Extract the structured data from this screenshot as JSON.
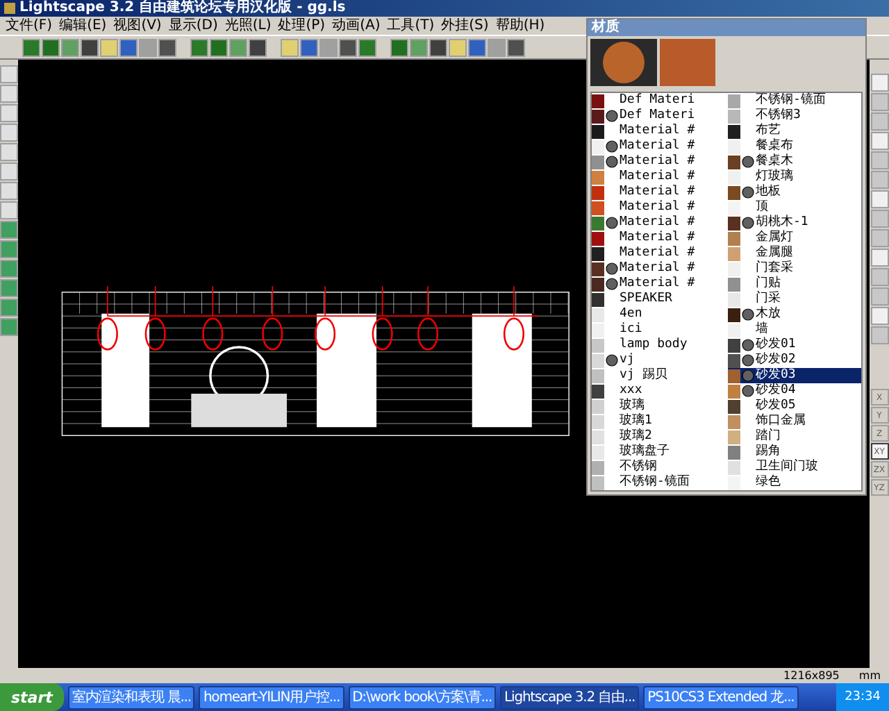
{
  "window": {
    "title": "Lightscape 3.2 自由建筑论坛专用汉化版 - gg.ls"
  },
  "menu": [
    "文件(F)",
    "编辑(E)",
    "视图(V)",
    "显示(D)",
    "光照(L)",
    "处理(P)",
    "动画(A)",
    "工具(T)",
    "外挂(S)",
    "帮助(H)"
  ],
  "axis_buttons": [
    {
      "label": "X",
      "selected": false
    },
    {
      "label": "Y",
      "selected": false
    },
    {
      "label": "Z",
      "selected": false
    },
    {
      "label": "XY",
      "selected": true
    },
    {
      "label": "ZX",
      "selected": false
    },
    {
      "label": "YZ",
      "selected": false
    }
  ],
  "materials_panel": {
    "title": "材质",
    "items": [
      {
        "label": "Def Materi",
        "textured": false,
        "selected": false,
        "color": "#7a1010"
      },
      {
        "label": "Def Materi",
        "textured": true,
        "selected": false,
        "color": "#5a1a1a"
      },
      {
        "label": "Material #",
        "textured": false,
        "selected": false,
        "color": "#1a1a1a"
      },
      {
        "label": "Material #",
        "textured": true,
        "selected": false,
        "color": "#f0f0f0"
      },
      {
        "label": "Material #",
        "textured": true,
        "selected": false,
        "color": "#909090"
      },
      {
        "label": "Material #",
        "textured": false,
        "selected": false,
        "color": "#d08040"
      },
      {
        "label": "Material #",
        "textured": false,
        "selected": false,
        "color": "#c03010"
      },
      {
        "label": "Material #",
        "textured": false,
        "selected": false,
        "color": "#d05020"
      },
      {
        "label": "Material #",
        "textured": true,
        "selected": false,
        "color": "#3a7a30"
      },
      {
        "label": "Material #",
        "textured": false,
        "selected": false,
        "color": "#a01010"
      },
      {
        "label": "Material #",
        "textured": false,
        "selected": false,
        "color": "#202020"
      },
      {
        "label": "Material #",
        "textured": true,
        "selected": false,
        "color": "#5a3020"
      },
      {
        "label": "Material #",
        "textured": true,
        "selected": false,
        "color": "#4a2a20"
      },
      {
        "label": "SPEAKER",
        "textured": false,
        "selected": false,
        "color": "#303030"
      },
      {
        "label": "4en",
        "textured": false,
        "selected": false,
        "color": "#e8e8e8"
      },
      {
        "label": "ici",
        "textured": false,
        "selected": false,
        "color": "#f0f0f0"
      },
      {
        "label": "lamp body",
        "textured": false,
        "selected": false,
        "color": "#c8c8c8"
      },
      {
        "label": "vj",
        "textured": true,
        "selected": false,
        "color": "#d8d8d8"
      },
      {
        "label": "vj 踢贝",
        "textured": false,
        "selected": false,
        "color": "#c0c0c0"
      },
      {
        "label": "xxx",
        "textured": false,
        "selected": false,
        "color": "#404040"
      },
      {
        "label": "玻璃",
        "textured": false,
        "selected": false,
        "color": "#d0d0d0"
      },
      {
        "label": "玻璃1",
        "textured": false,
        "selected": false,
        "color": "#d8d8d8"
      },
      {
        "label": "玻璃2",
        "textured": false,
        "selected": false,
        "color": "#e0e0e0"
      },
      {
        "label": "玻璃盘子",
        "textured": false,
        "selected": false,
        "color": "#e8e8e8"
      },
      {
        "label": "不锈钢",
        "textured": false,
        "selected": false,
        "color": "#b0b0b0"
      },
      {
        "label": "不锈钢-镜面",
        "textured": false,
        "selected": false,
        "color": "#c0c0c0"
      },
      {
        "label": "不锈钢-镜面",
        "textured": false,
        "selected": false,
        "color": "#a8a8a8"
      },
      {
        "label": "不锈钢3",
        "textured": false,
        "selected": false,
        "color": "#b8b8b8"
      },
      {
        "label": "布艺",
        "textured": false,
        "selected": false,
        "color": "#202020"
      },
      {
        "label": "餐桌布",
        "textured": false,
        "selected": false,
        "color": "#f0f0f0"
      },
      {
        "label": "餐桌木",
        "textured": true,
        "selected": false,
        "color": "#6a4020"
      },
      {
        "label": "灯玻璃",
        "textured": false,
        "selected": false,
        "color": "#f0f0f0"
      },
      {
        "label": "地板",
        "textured": true,
        "selected": false,
        "color": "#7a4a20"
      },
      {
        "label": "顶",
        "textured": false,
        "selected": false,
        "color": "#f4f4f4"
      },
      {
        "label": "胡桃木-1",
        "textured": true,
        "selected": false,
        "color": "#5a3020"
      },
      {
        "label": "金属灯",
        "textured": false,
        "selected": false,
        "color": "#b08050"
      },
      {
        "label": "金属腿",
        "textured": false,
        "selected": false,
        "color": "#d0a070"
      },
      {
        "label": "门套采",
        "textured": false,
        "selected": false,
        "color": "#f0f0f0"
      },
      {
        "label": "门贴",
        "textured": false,
        "selected": false,
        "color": "#909090"
      },
      {
        "label": "门采",
        "textured": false,
        "selected": false,
        "color": "#e8e8e8"
      },
      {
        "label": "木放",
        "textured": true,
        "selected": false,
        "color": "#3a2010"
      },
      {
        "label": "墙",
        "textured": false,
        "selected": false,
        "color": "#f0f0f0"
      },
      {
        "label": "砂发01",
        "textured": true,
        "selected": false,
        "color": "#404040"
      },
      {
        "label": "砂发02",
        "textured": true,
        "selected": false,
        "color": "#505050"
      },
      {
        "label": "砂发03",
        "textured": true,
        "selected": true,
        "color": "#a06030"
      },
      {
        "label": "砂发04",
        "textured": true,
        "selected": false,
        "color": "#c08040"
      },
      {
        "label": "砂发05",
        "textured": false,
        "selected": false,
        "color": "#504030"
      },
      {
        "label": "饰口金属",
        "textured": false,
        "selected": false,
        "color": "#c09060"
      },
      {
        "label": "踏门",
        "textured": false,
        "selected": false,
        "color": "#d0b080"
      },
      {
        "label": "踢角",
        "textured": false,
        "selected": false,
        "color": "#808080"
      },
      {
        "label": "卫生间门玻",
        "textured": false,
        "selected": false,
        "color": "#e0e0e0"
      },
      {
        "label": "绿色",
        "textured": false,
        "selected": false,
        "color": "#f4f4f4"
      }
    ]
  },
  "status_bar": {
    "size": "1216x895",
    "unit": "mm"
  },
  "taskbar": {
    "start": "start",
    "tasks": [
      {
        "label": "室内渲染和表现 晨...",
        "selected": false
      },
      {
        "label": "homeart-YILIN用户控...",
        "selected": false
      },
      {
        "label": "D:\\work book\\方案\\青...",
        "selected": false
      },
      {
        "label": "Lightscape 3.2 自由...",
        "selected": true
      },
      {
        "label": "PS10CS3 Extended 龙...",
        "selected": false
      }
    ],
    "clock": "23:34"
  }
}
